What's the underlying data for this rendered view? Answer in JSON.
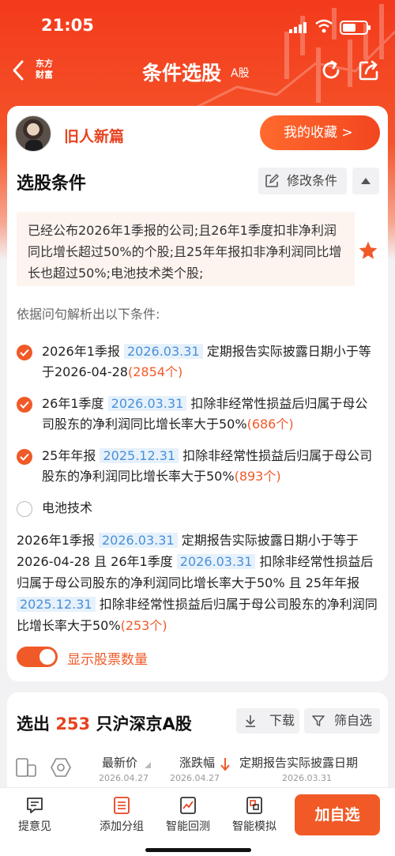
{
  "status_bar": {
    "time": "21:05"
  },
  "nav": {
    "logo": "东方财富",
    "title": "条件选股",
    "subtitle": "A股"
  },
  "user": {
    "name": "旧人新篇",
    "favorites_button": "我的收藏 >"
  },
  "conditions": {
    "title": "选股条件",
    "edit_button": "修改条件",
    "query": "已经公布2026年1季报的公司;且26年1季度扣非净利润同比增长超过50%的个股;且25年年报扣非净利润同比增长也超过50%;电池技术类个股;",
    "parse_label": "依据问句解析出以下条件:",
    "items": [
      {
        "checked": true,
        "prefix": "2026年1季报",
        "date": "2026.03.31",
        "text": "定期报告实际披露日期小于等于2026-04-28",
        "count": "(2854个)"
      },
      {
        "checked": true,
        "prefix": "26年1季度",
        "date": "2026.03.31",
        "text": "扣除非经常性损益后归属于母公司股东的净利润同比增长率大于50%",
        "count": "(686个)"
      },
      {
        "checked": true,
        "prefix": "25年年报",
        "date": "2025.12.31",
        "text": "扣除非经常性损益后归属于母公司股东的净利润同比增长率大于50%",
        "count": "(893个)"
      },
      {
        "checked": false,
        "prefix": "电池技术",
        "date": "",
        "text": "",
        "count": ""
      }
    ],
    "summary": {
      "p1": "2026年1季报",
      "d1": "2026.03.31",
      "p2": "定期报告实际披露日期小于等于2026-04-28 且 26年1季度",
      "d2": "2026.03.31",
      "p3": "扣除非经常性损益后归属于母公司股东的净利润同比增长率大于50% 且 25年年报",
      "d3": "2025.12.31",
      "p4": "扣除非经常性损益后归属于母公司股东的净利润同比增长率大于50%",
      "count": "(253个)"
    },
    "toggle_label": "显示股票数量",
    "toggle_on": true
  },
  "results": {
    "prefix": "选出",
    "count": "253",
    "suffix": "只沪深京A股",
    "download_button": "下载",
    "filter_button": "筛自选",
    "columns": [
      {
        "label": "最新价",
        "date": "2026.04.27"
      },
      {
        "label": "涨跌幅",
        "date": "2026.04.27"
      },
      {
        "label": "定期报告实际披露日期",
        "date": "2026.03.31"
      }
    ]
  },
  "bottom_bar": {
    "items": [
      "提意见",
      "添加分组",
      "智能回测",
      "智能模拟"
    ],
    "primary_button": "加自选"
  },
  "colors": {
    "accent": "#f05a28",
    "header": "#f33a1c",
    "link_date": "#4a90d9"
  }
}
